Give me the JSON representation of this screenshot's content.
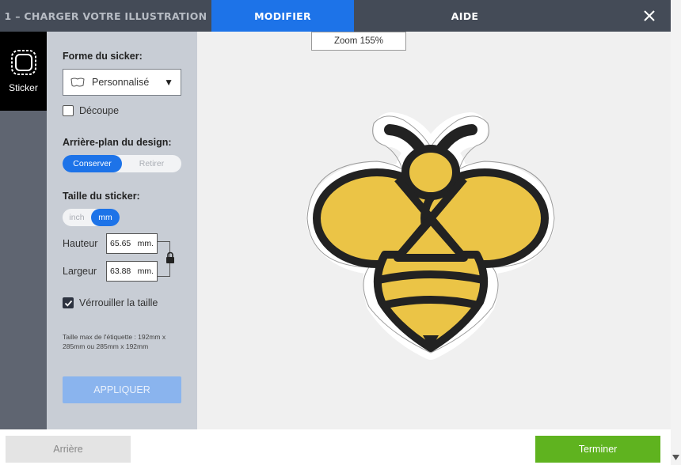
{
  "tabs": [
    {
      "label": "1 – CHARGER VOTRE ILLUSTRATION",
      "active": false
    },
    {
      "label": "MODIFIER",
      "active": true
    },
    {
      "label": "AIDE",
      "active": false
    }
  ],
  "rail": {
    "label": "Sticker",
    "icon": "sticker-shape-icon"
  },
  "panel": {
    "shape_title": "Forme du sicker:",
    "shape_value": "Personnalisé",
    "decoupe_label": "Découpe",
    "decoupe_checked": false,
    "background_title": "Arrière-plan du design:",
    "background_options": [
      "Conserver",
      "Retirer"
    ],
    "background_selected": "Conserver",
    "size_title": "Taille du sticker:",
    "unit_options": [
      "inch",
      "mm"
    ],
    "unit_selected": "mm",
    "height_label": "Hauteur",
    "height_value": "65.65",
    "width_label": "Largeur",
    "width_value": "63.88",
    "unit_suffix": "mm.",
    "lock_label": "Vérrouiller la taille",
    "lock_checked": true,
    "max_info": "Taille max de l'étiquette : 192mm x 285mm ou 285mm x 192mm",
    "apply_label": "APPLIQUER"
  },
  "canvas": {
    "zoom_label": "Zoom 155%"
  },
  "footer": {
    "back_label": "Arrière",
    "finish_label": "Terminer"
  },
  "colors": {
    "topbar": "#444b57",
    "accent": "#1d73e8",
    "finish": "#5fb31f",
    "bee_yellow": "#ebc446",
    "bee_dark": "#222222"
  }
}
